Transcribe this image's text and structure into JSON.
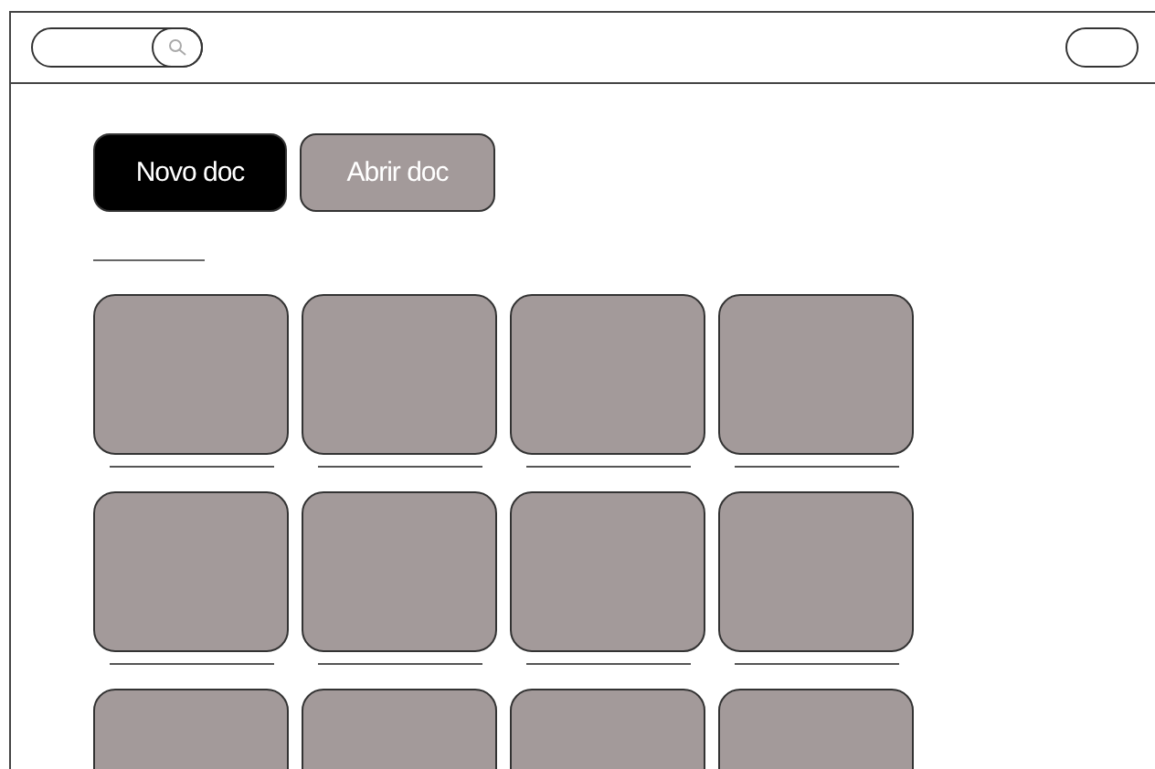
{
  "header": {
    "search": {
      "kind": "pill"
    },
    "profile": {
      "kind": "pill"
    }
  },
  "actions": [
    {
      "label": "Novo doc",
      "selected": true
    },
    {
      "label": "Abrir doc",
      "selected": false
    }
  ],
  "documents": [
    {
      "kind": "placeholder"
    },
    {
      "kind": "placeholder"
    },
    {
      "kind": "placeholder"
    },
    {
      "kind": "placeholder"
    },
    {
      "kind": "placeholder"
    },
    {
      "kind": "placeholder"
    },
    {
      "kind": "placeholder"
    },
    {
      "kind": "placeholder"
    },
    {
      "kind": "placeholder"
    },
    {
      "kind": "placeholder"
    },
    {
      "kind": "placeholder"
    },
    {
      "kind": "placeholder"
    }
  ]
}
